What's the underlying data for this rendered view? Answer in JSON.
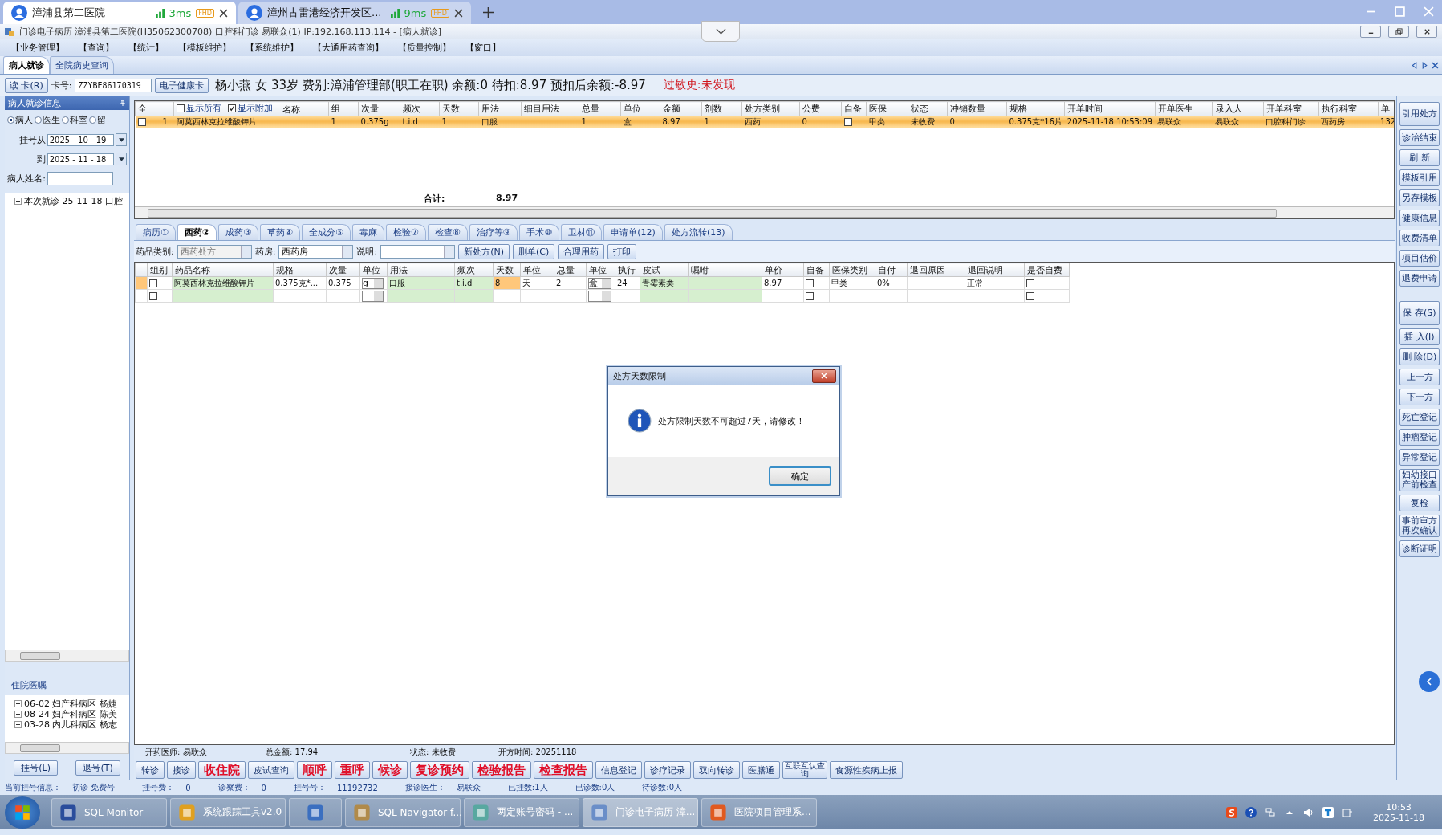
{
  "remote_bar": {
    "expanded": false
  },
  "browser_tabs": [
    {
      "title": "漳浦县第二医院",
      "latency": "3ms",
      "badge": "FHD",
      "selected": true
    },
    {
      "title": "漳州古雷港经济开发区...",
      "latency": "9ms",
      "badge": "FHD",
      "selected": false
    }
  ],
  "window": {
    "title": "门诊电子病历  漳浦县第二医院(H35062300708)  口腔科门诊  易联众(1) IP:192.168.113.114 - [病人就诊]"
  },
  "menu": [
    "【业务管理】",
    "【查询】",
    "【统计】",
    "【模板维护】",
    "【系统维护】",
    "【大通用药查询】",
    "【质量控制】",
    "【窗口】"
  ],
  "page_tabs": [
    {
      "label": "病人就诊",
      "selected": true
    },
    {
      "label": "全院病史查询",
      "selected": false
    }
  ],
  "patient": {
    "read_card": "读 卡(R)",
    "card_label": "卡号:",
    "card_value": "ZZYBE86170319",
    "health_card": "电子健康卡",
    "summary": "杨小燕  女  33岁  费别:漳浦管理部(职工在职)  余额:0  待扣:8.97  预扣后余额:-8.97",
    "allergy": "过敏史:未发现"
  },
  "left_panel": {
    "title": "病人就诊信息",
    "filters": [
      {
        "label": "病人",
        "selected": true
      },
      {
        "label": "医生",
        "selected": false
      },
      {
        "label": "科室",
        "selected": false
      },
      {
        "label": "留",
        "selected": false
      }
    ],
    "date_from_label": "挂号从",
    "date_from": "2025 - 10 - 19",
    "date_to_label": "到",
    "date_to": "2025 - 11 - 18",
    "name_label": "病人姓名:",
    "visits": [
      "本次就诊  25-11-18  口腔"
    ],
    "orders_title": "住院医嘱",
    "orders": [
      "06-02  妇产科病区  杨婕",
      "08-24  妇产科病区  陈美",
      "03-28  内儿科病区  杨志"
    ],
    "buttons": [
      "挂号(L)",
      "退号(T)"
    ]
  },
  "upper_grid": {
    "show_all": {
      "label": "显示所有",
      "checked": false
    },
    "show_extra": {
      "label": "显示附加",
      "checked": true
    },
    "columns": [
      "全",
      null,
      "名称",
      "组",
      "次量",
      "频次",
      "天数",
      "用法",
      "细目用法",
      "总量",
      "单位",
      "金额",
      "剂数",
      "处方类别",
      "公费",
      "自备",
      "医保",
      "状态",
      "冲销数量",
      "规格",
      "开单时间",
      "开单医生",
      "录入人",
      "开单科室",
      "执行科室",
      "单"
    ],
    "rows": [
      {
        "selected": true,
        "cells": [
          false,
          "1",
          "阿莫西林克拉维酸钾片",
          "1",
          "0.375g",
          "t.i.d",
          "1",
          "口服",
          null,
          "1",
          "盒",
          "8.97",
          "1",
          "西药",
          "0",
          false,
          "甲类",
          "未收费",
          "0",
          "0.375克*16片",
          "2025-11-18 10:53:09",
          "易联众",
          "易联众",
          "口腔科门诊",
          "西药房",
          "132"
        ]
      }
    ],
    "total_label": "合计:",
    "total_value": "8.97"
  },
  "tabs": [
    {
      "label": "病历①",
      "selected": false
    },
    {
      "label": "西药②",
      "selected": true
    },
    {
      "label": "成药③",
      "selected": false
    },
    {
      "label": "草药④",
      "selected": false
    },
    {
      "label": "全成分⑤",
      "selected": false
    },
    {
      "label": "毒麻",
      "selected": false
    },
    {
      "label": "检验⑦",
      "selected": false
    },
    {
      "label": "检查⑧",
      "selected": false
    },
    {
      "label": "治疗等⑨",
      "selected": false
    },
    {
      "label": "手术⑩",
      "selected": false
    },
    {
      "label": "卫材⑪",
      "selected": false
    },
    {
      "label": "申请单(12)",
      "selected": false
    },
    {
      "label": "处方流转(13)",
      "selected": false
    }
  ],
  "filter_bar": {
    "category_label": "药品类别:",
    "category": "西药处方",
    "pharmacy_label": "药房:",
    "pharmacy": "西药房",
    "note_label": "说明:",
    "buttons": [
      "新处方(N)",
      "删单(C)",
      "合理用药",
      "打印"
    ]
  },
  "lower_grid": {
    "columns": [
      {
        "kind": "text"
      },
      {
        "label": "组别",
        "kind": "check",
        "shaded": false
      },
      {
        "label": "药品名称",
        "kind": "text",
        "shaded": true
      },
      {
        "label": "规格",
        "kind": "text",
        "shaded": false
      },
      {
        "label": "次量",
        "kind": "text",
        "shaded": false
      },
      {
        "label": "单位",
        "kind": "select"
      },
      {
        "label": "用法",
        "kind": "text",
        "shaded": true
      },
      {
        "label": "频次",
        "kind": "text",
        "shaded": true
      },
      {
        "label": "天数",
        "kind": "text",
        "shaded": false
      },
      {
        "label": "单位",
        "kind": "text",
        "shaded": false
      },
      {
        "label": "总量",
        "kind": "text",
        "shaded": false
      },
      {
        "label": "单位",
        "kind": "select"
      },
      {
        "label": "执行",
        "kind": "text",
        "shaded": false
      },
      {
        "label": "皮试",
        "kind": "text",
        "shaded": true
      },
      {
        "label": "嘱咐",
        "kind": "text",
        "shaded": true
      },
      {
        "label": "单价",
        "kind": "text",
        "shaded": false
      },
      {
        "label": "自备",
        "kind": "check",
        "shaded": false
      },
      {
        "label": "医保类别",
        "kind": "text",
        "shaded": false
      },
      {
        "label": "自付",
        "kind": "text",
        "shaded": false
      },
      {
        "label": "退回原因",
        "kind": "text",
        "shaded": false
      },
      {
        "label": "退回说明",
        "kind": "text",
        "shaded": false
      },
      {
        "label": "是否自费",
        "kind": "check",
        "shaded": false
      }
    ],
    "rows": [
      {
        "selected": true,
        "cells": [
          null,
          false,
          "阿莫西林克拉维酸钾片",
          "0.375克*...",
          "0.375",
          "g",
          "口服",
          "t.i.d",
          {
            "text": "8",
            "focused": true
          },
          "天",
          "2",
          "盒",
          "24",
          "青霉素类",
          null,
          "8.97",
          false,
          "甲类",
          "0%",
          null,
          "正常",
          false
        ]
      },
      {
        "selected": false,
        "cells": [
          null,
          false,
          null,
          null,
          null,
          null,
          null,
          null,
          null,
          null,
          null,
          null,
          null,
          null,
          null,
          null,
          false,
          null,
          null,
          null,
          null,
          false
        ]
      }
    ]
  },
  "prescription_info": [
    {
      "label": "开药医师:",
      "value": "易联众"
    },
    {
      "label": "总金额:",
      "value": "17.94"
    },
    {
      "label": "状态:",
      "value": "未收费"
    },
    {
      "label": "开方时间:",
      "value": "20251118"
    }
  ],
  "action_buttons": [
    {
      "label": "转诊",
      "kind": "normal"
    },
    {
      "label": "接诊",
      "kind": "normal"
    },
    {
      "label": "收住院",
      "kind": "alert"
    },
    {
      "label": "皮试查询",
      "kind": "normal"
    },
    {
      "label": "顺呼",
      "kind": "alert"
    },
    {
      "label": "重呼",
      "kind": "alert"
    },
    {
      "label": "候诊",
      "kind": "alert"
    },
    {
      "label": "复诊预约",
      "kind": "alert"
    },
    {
      "label": "检验报告",
      "kind": "alert"
    },
    {
      "label": "检查报告",
      "kind": "alert"
    },
    {
      "label": "信息登记",
      "kind": "normal"
    },
    {
      "label": "诊疗记录",
      "kind": "normal"
    },
    {
      "label": "双向转诊",
      "kind": "normal"
    },
    {
      "label": "医膳通",
      "kind": "normal"
    },
    {
      "label": "互联互认查询",
      "kind": "small"
    },
    {
      "label": "食源性疾病上报",
      "kind": "normal"
    }
  ],
  "side_buttons": [
    "引用处方",
    "诊治结束",
    "刷 新",
    "模板引用",
    "另存模板",
    "健康信息",
    "收费清单",
    "项目估价",
    "退费申请"
  ],
  "side_actions": [
    "保 存(S)",
    "插 入(I)",
    "删 除(D)",
    "上一方",
    "下一方",
    "死亡登记",
    "肿瘤登记",
    "异常登记",
    "妇幼接口产前检查",
    "复检",
    "事前审方再次确认",
    "诊断证明"
  ],
  "status_bar": [
    {
      "label": "当前挂号信息：",
      "value": "初诊 免费号"
    },
    {
      "label": "挂号费：",
      "value": "0"
    },
    {
      "label": "诊察费：",
      "value": "0"
    },
    {
      "label": "挂号号：",
      "value": "11192732"
    },
    {
      "label": "接诊医生：",
      "value": "易联众"
    },
    {
      "label": "已挂数:1人"
    },
    {
      "label": "已诊数:0人"
    },
    {
      "label": "待诊数:0人"
    }
  ],
  "dialog": {
    "title": "处方天数限制",
    "message": "处方限制天数不可超过7天，请修改！",
    "button": "确定"
  },
  "taskbar": {
    "items": [
      {
        "label": "SQL Monitor",
        "selected": false
      },
      {
        "label": "系统跟踪工具v2.0",
        "selected": false
      },
      {
        "selected": false
      },
      {
        "label": "SQL Navigator f...",
        "selected": false
      },
      {
        "label": "两定账号密码 - ...",
        "selected": false
      },
      {
        "label": "门诊电子病历  漳...",
        "selected": true
      },
      {
        "label": "医院项目管理系...",
        "selected": false
      }
    ],
    "time": "10:53",
    "date": "2025-11-18"
  }
}
